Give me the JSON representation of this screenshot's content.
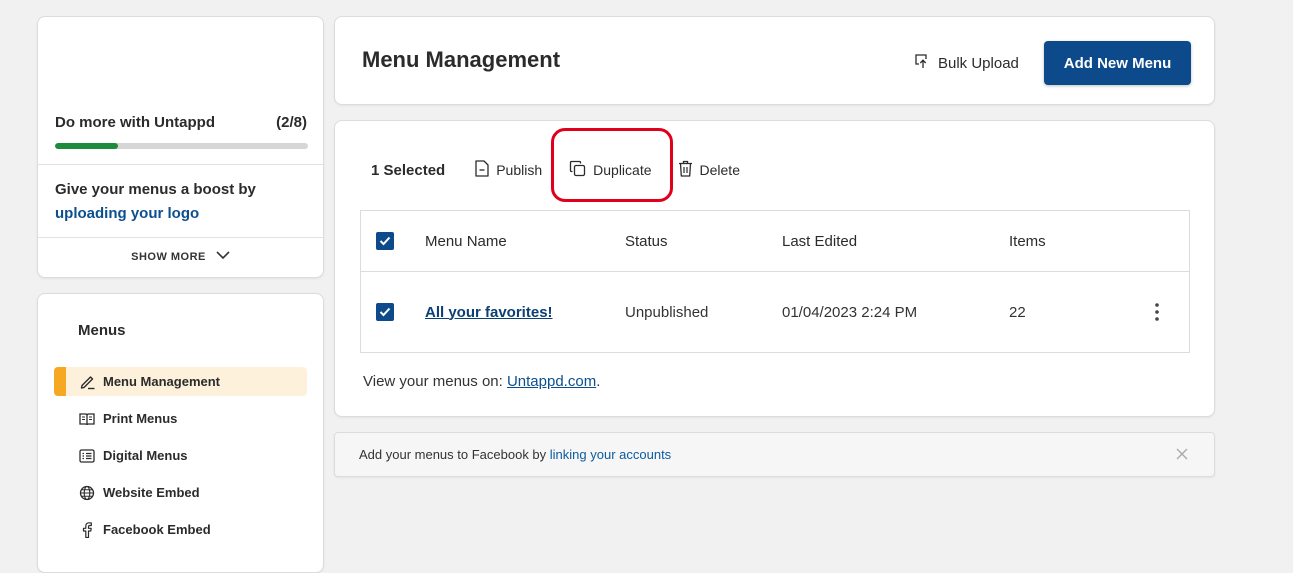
{
  "promo": {
    "title": "Do more with Untappd",
    "progress_text": "(2/8)",
    "progress_fraction": 0.25,
    "boost_text": "Give your menus a boost by ",
    "boost_link": "uploading your logo",
    "show_more": "SHOW MORE"
  },
  "nav": {
    "title": "Menus",
    "items": [
      {
        "label": "Menu Management",
        "icon": "pencil-icon",
        "active": true
      },
      {
        "label": "Print Menus",
        "icon": "book-icon",
        "active": false
      },
      {
        "label": "Digital Menus",
        "icon": "list-icon",
        "active": false
      },
      {
        "label": "Website Embed",
        "icon": "globe-icon",
        "active": false
      },
      {
        "label": "Facebook Embed",
        "icon": "facebook-icon",
        "active": false
      }
    ]
  },
  "header": {
    "title": "Menu Management",
    "bulk_upload": "Bulk Upload",
    "add_new": "Add New Menu"
  },
  "toolbar": {
    "selected": "1 Selected",
    "publish": "Publish",
    "duplicate": "Duplicate",
    "delete": "Delete"
  },
  "table": {
    "columns": [
      "Menu Name",
      "Status",
      "Last Edited",
      "Items"
    ],
    "rows": [
      {
        "name": "All your favorites!",
        "status": "Unpublished",
        "last_edited": "01/04/2023 2:24 PM",
        "items": "22",
        "checked": true
      }
    ]
  },
  "view_on": {
    "text": "View your menus on: ",
    "link": "Untappd.com",
    "suffix": "."
  },
  "facebook": {
    "text": "Add your menus to Facebook by ",
    "link": "linking your accounts"
  },
  "colors": {
    "primary": "#0d4a8c",
    "progress": "#1e8a3b",
    "active_accent": "#f7a823",
    "highlight": "#e0001b"
  }
}
